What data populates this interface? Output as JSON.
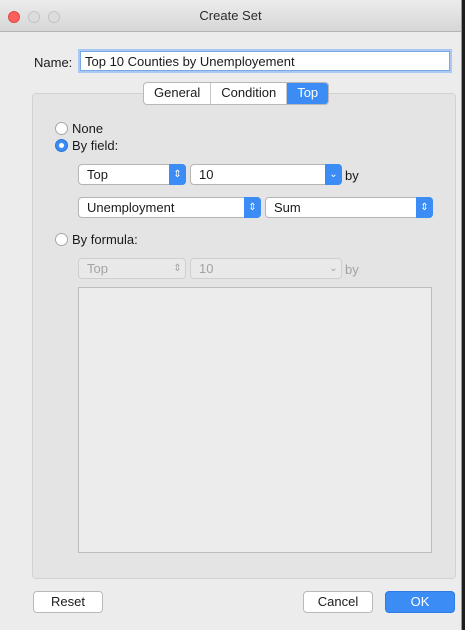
{
  "window": {
    "title": "Create Set"
  },
  "name_field": {
    "label": "Name:",
    "value": "Top 10 Counties by Unemployement"
  },
  "tabs": [
    {
      "label": "General",
      "active": false
    },
    {
      "label": "Condition",
      "active": false
    },
    {
      "label": "Top",
      "active": true
    }
  ],
  "options": {
    "none_label": "None",
    "by_field_label": "By field:",
    "by_formula_label": "By formula:",
    "selected": "by_field"
  },
  "by_field": {
    "direction": "Top",
    "count": "10",
    "by_label": "by",
    "field": "Unemployment",
    "aggregation": "Sum"
  },
  "by_formula": {
    "direction": "Top",
    "count": "10",
    "by_label": "by",
    "formula": ""
  },
  "buttons": {
    "reset": "Reset",
    "cancel": "Cancel",
    "ok": "OK"
  },
  "colors": {
    "accent": "#3b8cf5",
    "close": "#fc605c"
  },
  "icons": {
    "stepper": "updown-chevron-icon",
    "dropdown": "chevron-down-icon"
  }
}
